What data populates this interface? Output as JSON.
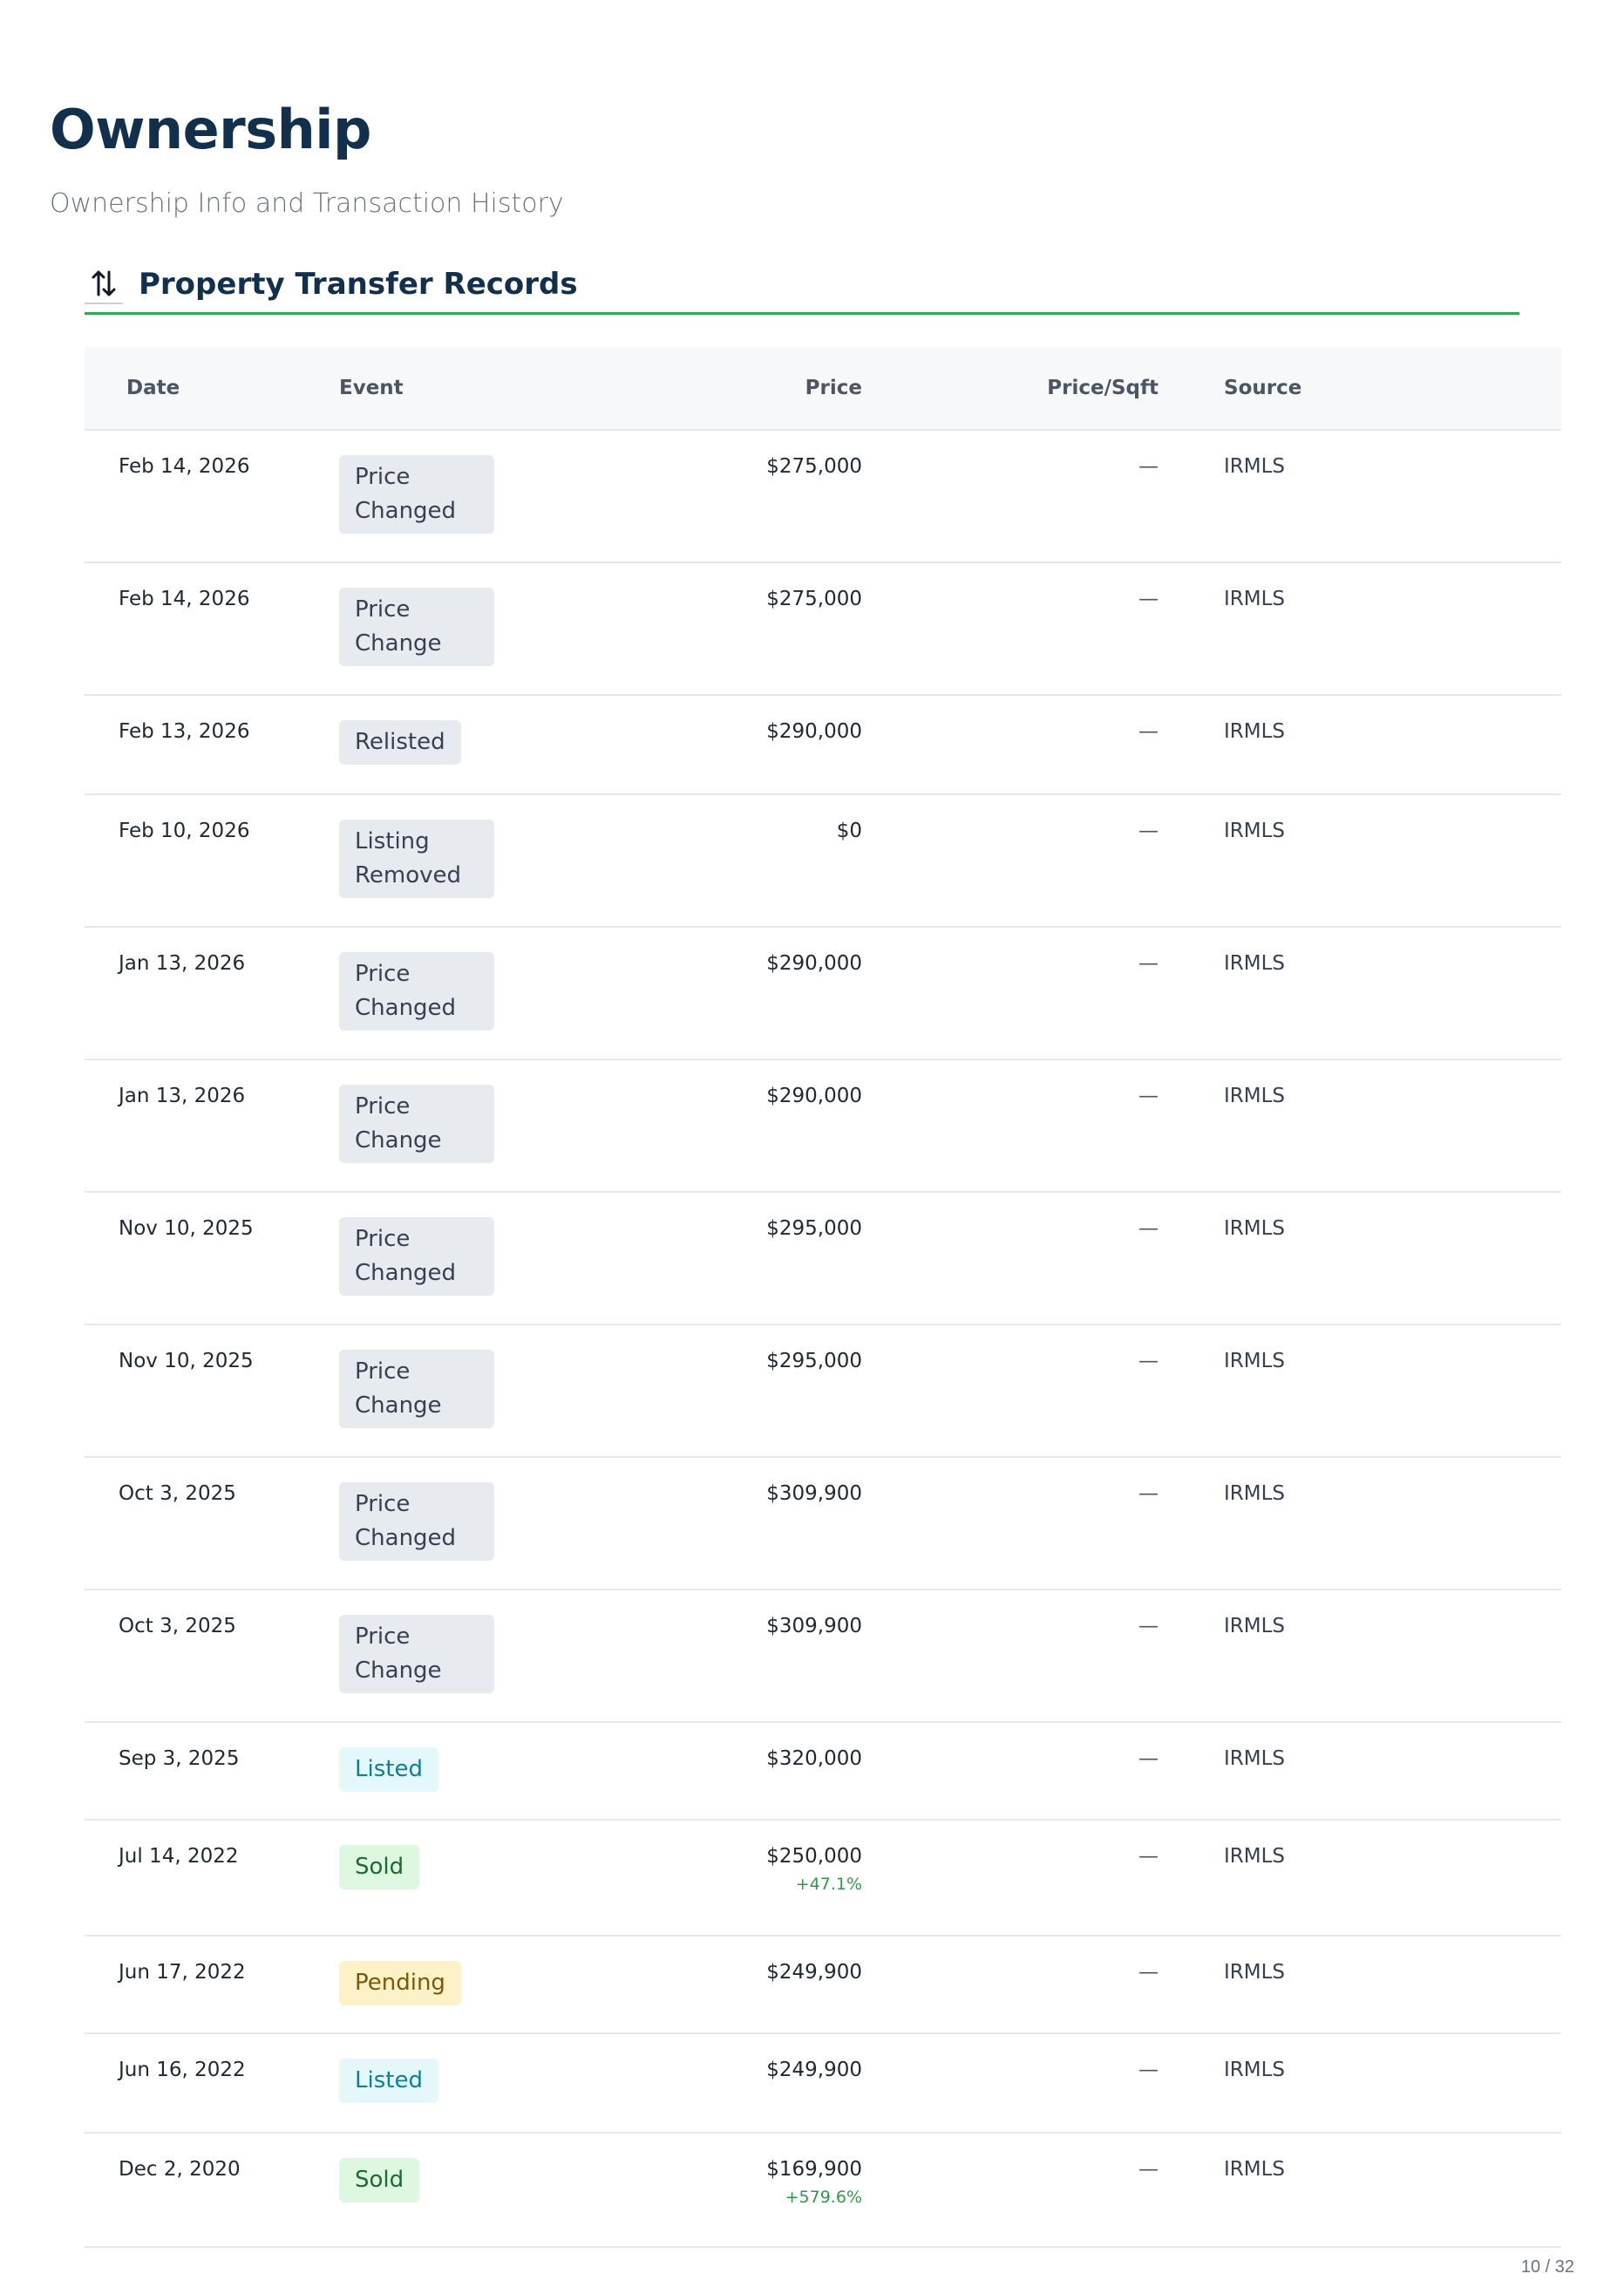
{
  "page": {
    "title": "Ownership",
    "subtitle": "Ownership Info and Transaction History",
    "page_indicator": "10 / 32"
  },
  "section": {
    "title": "Property Transfer Records",
    "icon": "arrows-up-down-icon"
  },
  "table": {
    "headers": {
      "date": "Date",
      "event": "Event",
      "price": "Price",
      "price_sqft": "Price/Sqft",
      "source": "Source"
    },
    "rows": [
      {
        "date": "Feb 14, 2026",
        "event": "Price Changed",
        "event_type": "neutral",
        "price": "$275,000",
        "change": "",
        "price_sqft": "—",
        "source": "IRMLS"
      },
      {
        "date": "Feb 14, 2026",
        "event": "Price Change",
        "event_type": "neutral",
        "price": "$275,000",
        "change": "",
        "price_sqft": "—",
        "source": "IRMLS"
      },
      {
        "date": "Feb 13, 2026",
        "event": "Relisted",
        "event_type": "neutral",
        "price": "$290,000",
        "change": "",
        "price_sqft": "—",
        "source": "IRMLS"
      },
      {
        "date": "Feb 10, 2026",
        "event": "Listing Removed",
        "event_type": "neutral",
        "price": "$0",
        "change": "",
        "price_sqft": "—",
        "source": "IRMLS"
      },
      {
        "date": "Jan 13, 2026",
        "event": "Price Changed",
        "event_type": "neutral",
        "price": "$290,000",
        "change": "",
        "price_sqft": "—",
        "source": "IRMLS"
      },
      {
        "date": "Jan 13, 2026",
        "event": "Price Change",
        "event_type": "neutral",
        "price": "$290,000",
        "change": "",
        "price_sqft": "—",
        "source": "IRMLS"
      },
      {
        "date": "Nov 10, 2025",
        "event": "Price Changed",
        "event_type": "neutral",
        "price": "$295,000",
        "change": "",
        "price_sqft": "—",
        "source": "IRMLS"
      },
      {
        "date": "Nov 10, 2025",
        "event": "Price Change",
        "event_type": "neutral",
        "price": "$295,000",
        "change": "",
        "price_sqft": "—",
        "source": "IRMLS"
      },
      {
        "date": "Oct 3, 2025",
        "event": "Price Changed",
        "event_type": "neutral",
        "price": "$309,900",
        "change": "",
        "price_sqft": "—",
        "source": "IRMLS"
      },
      {
        "date": "Oct 3, 2025",
        "event": "Price Change",
        "event_type": "neutral",
        "price": "$309,900",
        "change": "",
        "price_sqft": "—",
        "source": "IRMLS"
      },
      {
        "date": "Sep 3, 2025",
        "event": "Listed",
        "event_type": "listed",
        "price": "$320,000",
        "change": "",
        "price_sqft": "—",
        "source": "IRMLS"
      },
      {
        "date": "Jul 14, 2022",
        "event": "Sold",
        "event_type": "sold",
        "price": "$250,000",
        "change": "+47.1%",
        "price_sqft": "—",
        "source": "IRMLS"
      },
      {
        "date": "Jun 17, 2022",
        "event": "Pending",
        "event_type": "pending",
        "price": "$249,900",
        "change": "",
        "price_sqft": "—",
        "source": "IRMLS"
      },
      {
        "date": "Jun 16, 2022",
        "event": "Listed",
        "event_type": "listed",
        "price": "$249,900",
        "change": "",
        "price_sqft": "—",
        "source": "IRMLS"
      },
      {
        "date": "Dec 2, 2020",
        "event": "Sold",
        "event_type": "sold",
        "price": "$169,900",
        "change": "+579.6%",
        "price_sqft": "—",
        "source": "IRMLS"
      }
    ]
  },
  "colors": {
    "title": "#12304d",
    "accent_rule": "#2fa84f",
    "positive_change": "#2f9b48"
  }
}
